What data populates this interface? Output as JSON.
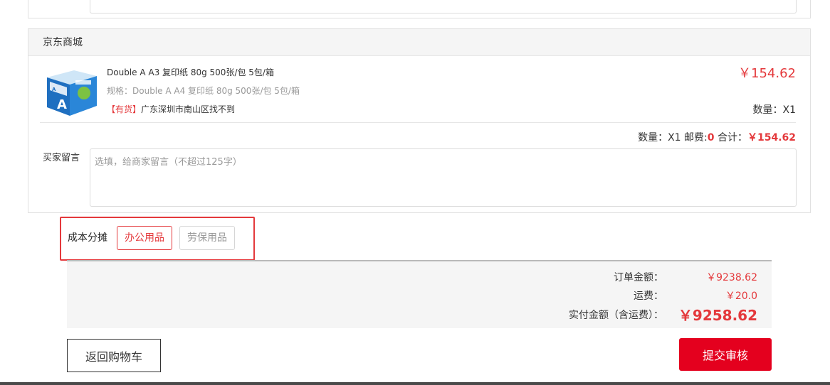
{
  "store": {
    "name": "京东商城",
    "product": {
      "name": "Double A A3 复印纸 80g 500张/包 5包/箱",
      "spec": "规格：Double A A4 复印纸 80g 500张/包 5包/箱",
      "stock_tag": "【有货】",
      "stock_location": "广东深圳市南山区找不到",
      "price": "￥154.62",
      "quantity": "数量：X1"
    },
    "summary": {
      "qty": "数量：X1",
      "shipping_label": "邮费:",
      "shipping_value": "0",
      "subtotal_label": "合计：",
      "subtotal_value": "￥154.62"
    },
    "memo": {
      "label": "买家留言",
      "placeholder": "选填，给商家留言（不超过125字）"
    }
  },
  "allocation": {
    "label": "成本分摊",
    "options": [
      "办公用品",
      "劳保用品"
    ],
    "selected": "办公用品"
  },
  "totals": {
    "order_amount_label": "订单金额：",
    "order_amount_value": "￥9238.62",
    "freight_label": "运费：",
    "freight_value": "￥20.0",
    "paid_label": "实付金额（含运费）：",
    "paid_value": "￥9258.62"
  },
  "actions": {
    "back_label": "返回购物车",
    "submit_label": "提交审核"
  },
  "colors": {
    "accent_red": "#e4393c",
    "submit_red": "#e4001e"
  }
}
